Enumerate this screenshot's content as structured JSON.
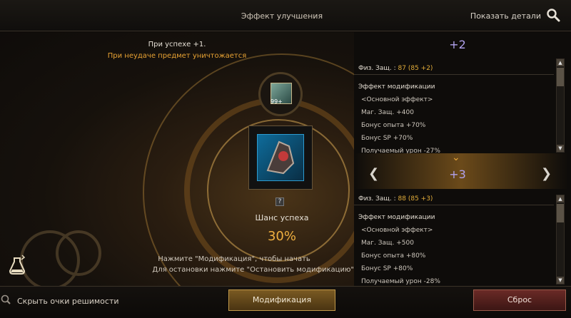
{
  "header": {
    "title": "Эффект улучшения",
    "details_label": "Показать детали",
    "details_icon": "magnifier-icon"
  },
  "enhance": {
    "on_success": "При успехе +1.",
    "on_failure": "При неудаче предмет уничтожается",
    "scroll_count": "99+",
    "scroll_icon": "enhancement-scroll-icon",
    "item_icon": "equipment-item-icon",
    "help_glyph": "?",
    "chance_label": "Шанс успеха",
    "chance_value": "30%",
    "chance_fraction": 0.3,
    "instruction_1": "Нажмите \"Модификация\", чтобы начать",
    "instruction_2": "Для остановки нажмите \"Остановить модификацию\"",
    "potion_icon": "potion-icon"
  },
  "preview": {
    "levels": [
      {
        "level": "+2",
        "stat_label": "Физ. Защ. :",
        "stat_value": "87",
        "stat_detail": "(85 +2)",
        "mod_title": "Эффект модификации",
        "main_effect": "<Основной эффект>",
        "effects": [
          "Маг. Защ. +400",
          "Бонус опыта +70%",
          "Бонус SP +70%",
          "Получаемый урон -27%"
        ]
      },
      {
        "level": "+3",
        "stat_label": "Физ. Защ. :",
        "stat_value": "88",
        "stat_detail": "(85 +3)",
        "mod_title": "Эффект модификации",
        "main_effect": "<Основной эффект>",
        "effects": [
          "Маг. Защ. +500",
          "Бонус опыта +80%",
          "Бонус SP +80%",
          "Получаемый урон -28%"
        ]
      }
    ],
    "prev_arrow": "❮",
    "next_arrow": "❯",
    "chevron": "⌄",
    "scroll_up": "▲",
    "scroll_down": "▼"
  },
  "footer": {
    "hide_label": "Скрыть очки решимости",
    "modify_button": "Модификация",
    "reset_button": "Сброс"
  },
  "colors": {
    "accent_gold": "#e2ad3a",
    "failure_orange": "#e8a233",
    "level_purple": "#b1a2ee"
  }
}
